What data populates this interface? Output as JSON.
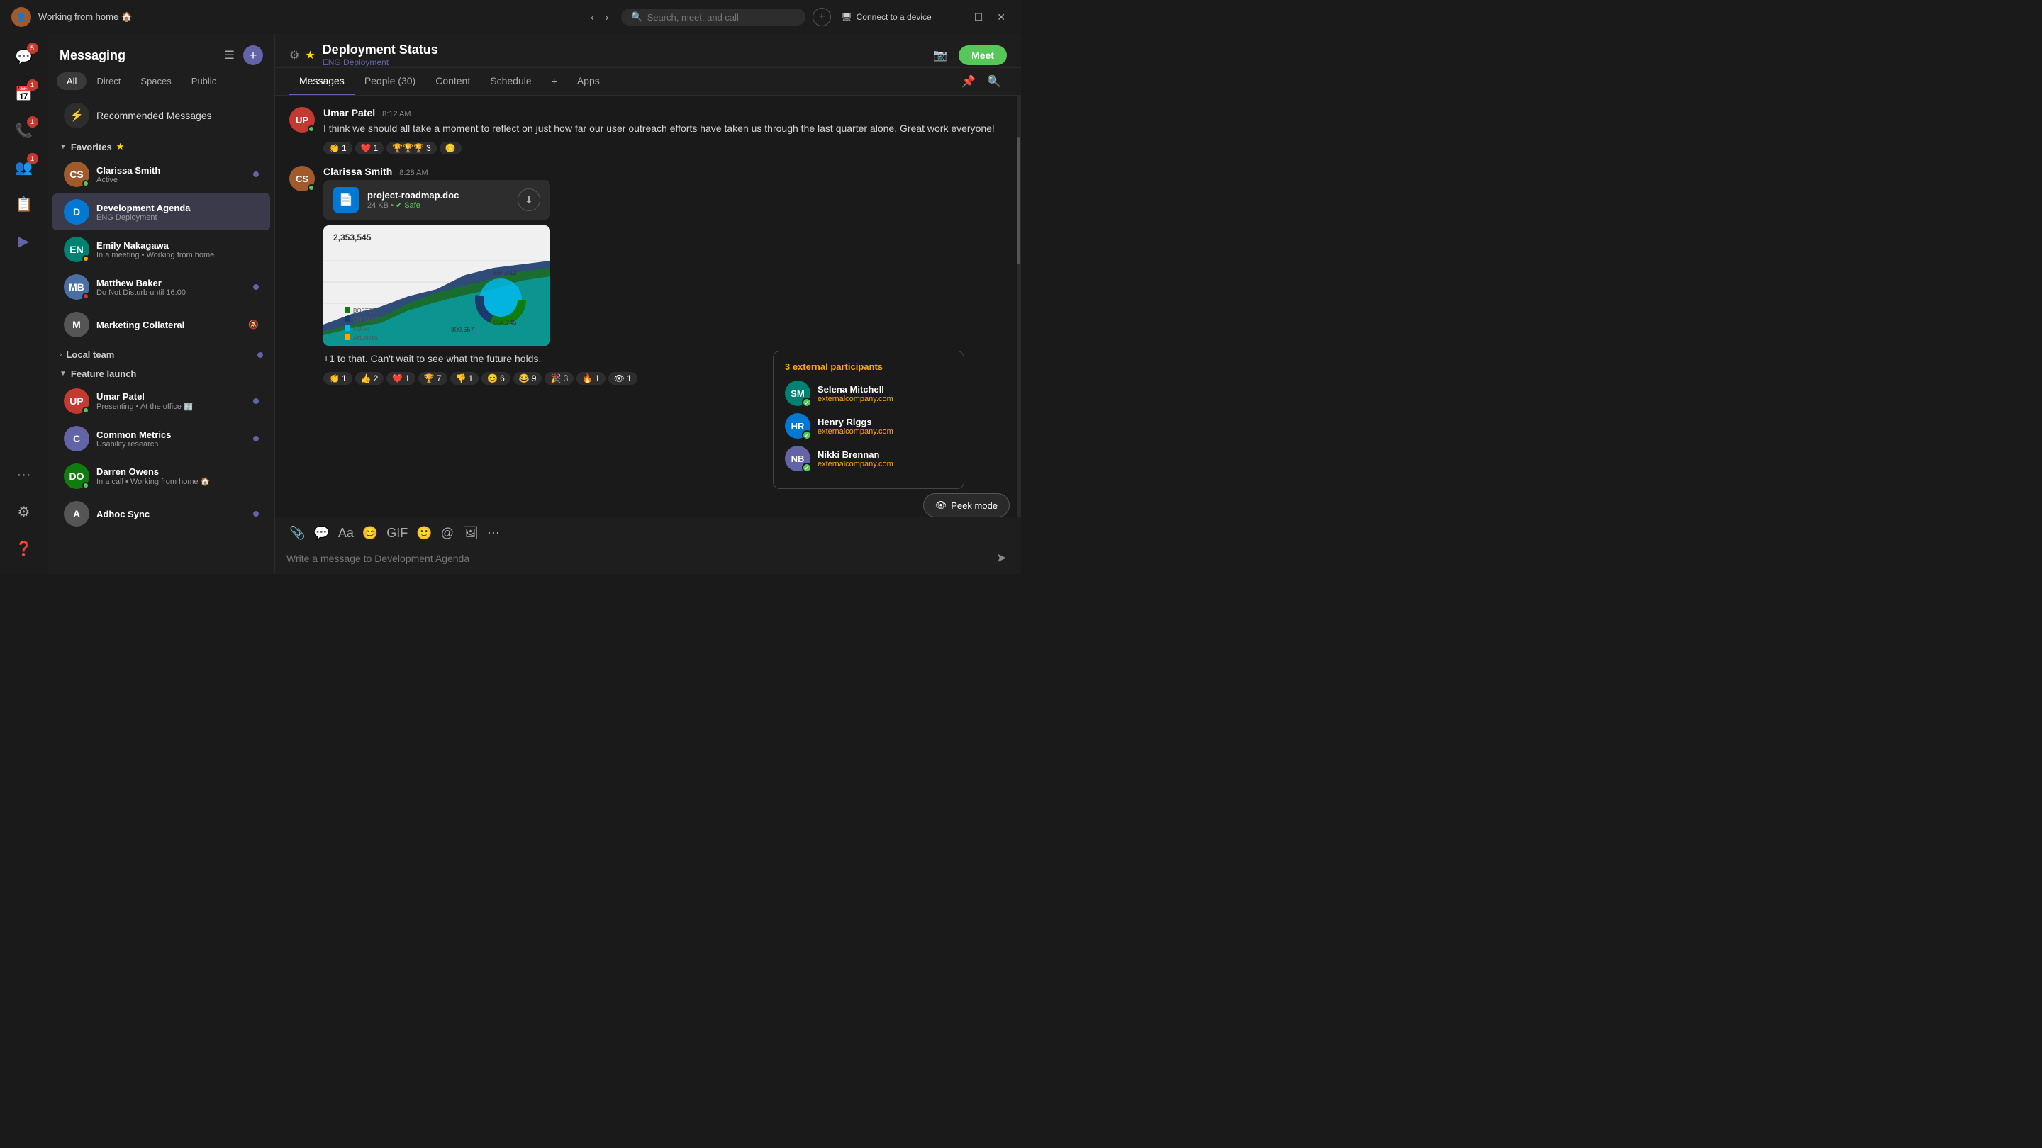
{
  "titlebar": {
    "user_status": "Working from home 🏠",
    "search_placeholder": "Search, meet, and call",
    "connect_label": "Connect to a device"
  },
  "nav": {
    "items": [
      {
        "id": "chat",
        "icon": "💬",
        "badge": "5",
        "label": "Chat"
      },
      {
        "id": "calendar",
        "icon": "📅",
        "badge": "1",
        "label": "Calendar"
      },
      {
        "id": "calls",
        "icon": "📞",
        "badge": "1",
        "label": "Calls"
      },
      {
        "id": "people",
        "icon": "👥",
        "badge": "1",
        "label": "People"
      },
      {
        "id": "contacts",
        "icon": "📋",
        "badge": "",
        "label": "Contacts"
      },
      {
        "id": "activity",
        "icon": "▶",
        "badge": "",
        "label": "Activity"
      },
      {
        "id": "more",
        "icon": "···",
        "badge": "",
        "label": "More"
      }
    ]
  },
  "sidebar": {
    "title": "Messaging",
    "tabs": [
      {
        "id": "all",
        "label": "All",
        "active": true
      },
      {
        "id": "direct",
        "label": "Direct"
      },
      {
        "id": "spaces",
        "label": "Spaces"
      },
      {
        "id": "public",
        "label": "Public"
      }
    ],
    "recommended": {
      "label": "Recommended Messages",
      "icon": "⚡"
    },
    "favorites": {
      "label": "Favorites",
      "items": [
        {
          "id": "clarissa",
          "name": "Clarissa Smith",
          "status": "Active",
          "status_type": "active",
          "avatar_color": "av-brown",
          "initials": "CS",
          "unread": true
        },
        {
          "id": "dev-agenda",
          "name": "Development Agenda",
          "status": "ENG Deployment",
          "status_type": "group",
          "avatar_color": "av-blue",
          "initials": "D",
          "unread": false,
          "active": true
        },
        {
          "id": "emily",
          "name": "Emily Nakagawa",
          "status": "In a meeting • Working from home",
          "status_type": "meeting",
          "avatar_color": "av-teal",
          "initials": "EN",
          "unread": false
        },
        {
          "id": "matthew",
          "name": "Matthew Baker",
          "status": "Do Not Disturb until 16:00",
          "status_type": "dnd",
          "avatar_color": "av-slate",
          "initials": "MB",
          "unread": true
        },
        {
          "id": "marketing",
          "name": "Marketing Collateral",
          "status": "",
          "status_type": "group",
          "avatar_color": "av-purple",
          "initials": "M",
          "unread": false,
          "muted": true
        }
      ]
    },
    "local_team": {
      "label": "Local team",
      "unread": true
    },
    "feature_launch": {
      "label": "Feature launch",
      "items": [
        {
          "id": "umar",
          "name": "Umar Patel",
          "status": "Presenting • At the office 🏢",
          "status_type": "active",
          "avatar_color": "av-red",
          "initials": "UP",
          "unread": true
        },
        {
          "id": "common",
          "name": "Common Metrics",
          "status": "Usability research",
          "status_type": "group",
          "avatar_color": "av-purple",
          "initials": "C",
          "unread": true
        },
        {
          "id": "darren",
          "name": "Darren Owens",
          "status": "In a call • Working from home 🏠",
          "status_type": "call",
          "avatar_color": "av-green",
          "initials": "DO",
          "unread": false
        },
        {
          "id": "adhoc",
          "name": "Adhoc Sync",
          "status": "",
          "status_type": "group",
          "avatar_color": "av-purple",
          "initials": "A",
          "unread": true
        }
      ]
    }
  },
  "main": {
    "channel_name": "Deployment Status",
    "channel_sub": "ENG Deployment",
    "tabs": [
      {
        "id": "messages",
        "label": "Messages",
        "active": true
      },
      {
        "id": "people",
        "label": "People (30)"
      },
      {
        "id": "content",
        "label": "Content"
      },
      {
        "id": "schedule",
        "label": "Schedule"
      },
      {
        "id": "apps",
        "label": "Apps"
      }
    ],
    "meet_button": "Meet",
    "messages": [
      {
        "id": "msg1",
        "author": "Umar Patel",
        "time": "8:12 AM",
        "avatar_color": "av-red",
        "initials": "UP",
        "text": "I think we should all take a moment to reflect on just how far our user outreach efforts have taken us through the last quarter alone. Great work everyone!",
        "reactions": [
          {
            "emoji": "👏",
            "count": "1"
          },
          {
            "emoji": "❤️",
            "count": "1"
          },
          {
            "emoji": "🏆🏆🏆",
            "count": "3"
          },
          {
            "emoji": "😊",
            "count": ""
          }
        ]
      },
      {
        "id": "msg2",
        "author": "Clarissa Smith",
        "time": "8:28 AM",
        "avatar_color": "av-brown",
        "initials": "CS",
        "has_file": true,
        "file_name": "project-roadmap.doc",
        "file_size": "24 KB",
        "file_safe": "Safe",
        "has_chart": true,
        "chart_value": "2,353,545",
        "text": "+1 to that. Can't wait to see what the future holds.",
        "reactions": [
          {
            "emoji": "👏",
            "count": "1"
          },
          {
            "emoji": "👍",
            "count": "2"
          },
          {
            "emoji": "❤️",
            "count": "1"
          },
          {
            "emoji": "🏆",
            "count": "7"
          },
          {
            "emoji": "👎",
            "count": "1"
          },
          {
            "emoji": "😊",
            "count": "6"
          },
          {
            "emoji": "😂",
            "count": "9"
          },
          {
            "emoji": "🎉",
            "count": "3"
          },
          {
            "emoji": "🔥",
            "count": "1"
          },
          {
            "emoji": "👁️",
            "count": "1"
          }
        ]
      }
    ],
    "input_placeholder": "Write a message to Development Agenda"
  },
  "external_popup": {
    "title": "3 external participants",
    "people": [
      {
        "name": "Selena Mitchell",
        "company": "externalcompany.com",
        "color": "av-teal",
        "initials": "SM"
      },
      {
        "name": "Henry Riggs",
        "company": "externalcompany.com",
        "color": "av-blue",
        "initials": "HR"
      },
      {
        "name": "Nikki Brennan",
        "company": "externalcompany.com",
        "color": "av-purple",
        "initials": "NB"
      }
    ]
  },
  "peek_button": {
    "label": "Peek mode",
    "icon": "👁"
  }
}
